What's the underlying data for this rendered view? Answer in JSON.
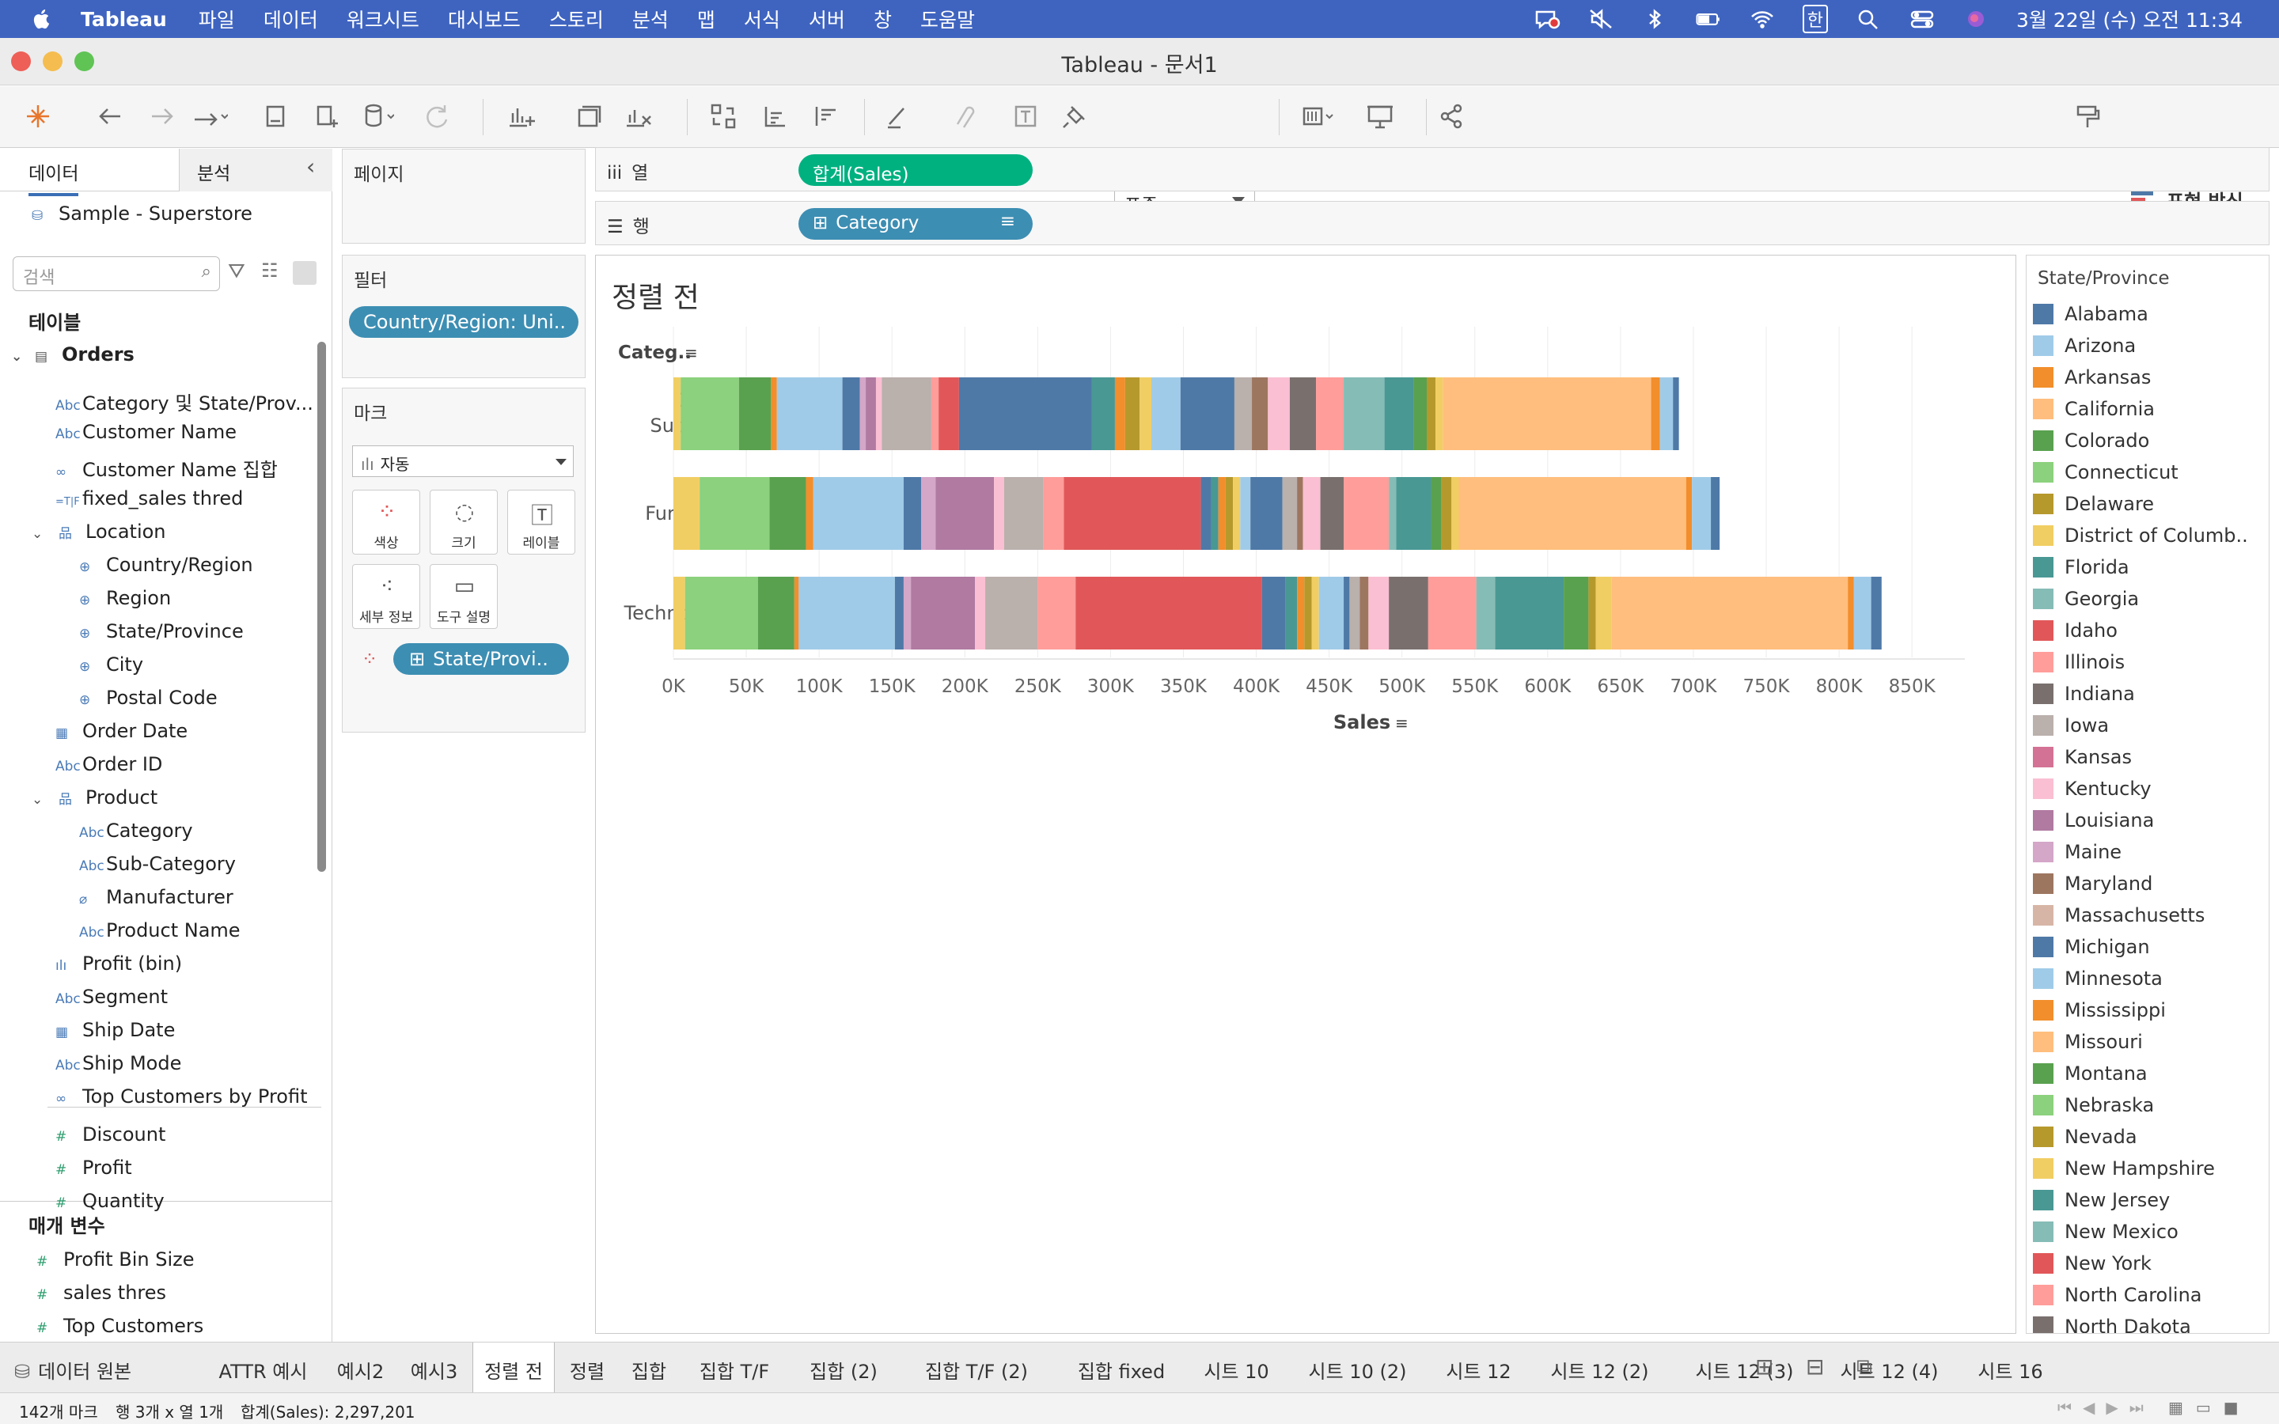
{
  "menubar": {
    "app": "Tableau",
    "items": [
      "파일",
      "데이터",
      "워크시트",
      "대시보드",
      "스토리",
      "분석",
      "맵",
      "서식",
      "서버",
      "창",
      "도움말"
    ],
    "clock": "3월 22일 (수) 오전 11:34",
    "input_lang": "한"
  },
  "window": {
    "title": "Tableau - 문서1"
  },
  "toolbar": {
    "fit": "표준",
    "show_me": "표현 방식"
  },
  "left": {
    "tab_data": "데이터",
    "tab_analytics": "분석",
    "datasource": "Sample - Superstore",
    "search_placeholder": "검색",
    "tables_header": "테이블",
    "table": "Orders",
    "fields": [
      {
        "icon": "Abc",
        "name": "Category 및 State/Prov..."
      },
      {
        "icon": "Abc",
        "name": "Customer Name"
      },
      {
        "icon": "∞",
        "name": "Customer Name 집합"
      },
      {
        "icon": "=T|F",
        "name": "fixed_sales thred"
      },
      {
        "icon": "品",
        "name": "Location"
      },
      {
        "icon": "⊕",
        "name": "Country/Region"
      },
      {
        "icon": "⊕",
        "name": "Region"
      },
      {
        "icon": "⊕",
        "name": "State/Province"
      },
      {
        "icon": "⊕",
        "name": "City"
      },
      {
        "icon": "⊕",
        "name": "Postal Code"
      },
      {
        "icon": "▦",
        "name": "Order Date"
      },
      {
        "icon": "Abc",
        "name": "Order ID"
      },
      {
        "icon": "品",
        "name": "Product"
      },
      {
        "icon": "Abc",
        "name": "Category"
      },
      {
        "icon": "Abc",
        "name": "Sub-Category"
      },
      {
        "icon": "⌀",
        "name": "Manufacturer"
      },
      {
        "icon": "Abc",
        "name": "Product Name"
      },
      {
        "icon": "ılı",
        "name": "Profit (bin)"
      },
      {
        "icon": "Abc",
        "name": "Segment"
      },
      {
        "icon": "▦",
        "name": "Ship Date"
      },
      {
        "icon": "Abc",
        "name": "Ship Mode"
      },
      {
        "icon": "∞",
        "name": "Top Customers by Profit"
      },
      {
        "icon": "#",
        "name": "Discount"
      },
      {
        "icon": "#",
        "name": "Profit"
      },
      {
        "icon": "#",
        "name": "Quantity"
      }
    ],
    "params_header": "매개 변수",
    "params": [
      "Profit Bin Size",
      "sales thres",
      "Top Customers"
    ]
  },
  "pages": {
    "title": "페이지"
  },
  "filters": {
    "title": "필터",
    "pill": "Country/Region: Uni.."
  },
  "marks": {
    "title": "마크",
    "type": "자동",
    "buttons": [
      "색상",
      "크기",
      "레이블",
      "세부 정보",
      "도구 설명"
    ],
    "pill": "State/Provi.."
  },
  "shelves": {
    "columns_label": "열",
    "columns_pill": "합계(Sales)",
    "rows_label": "행",
    "rows_pill": "Category"
  },
  "chart_data": {
    "type": "bar",
    "stacked": true,
    "orientation": "horizontal",
    "title": "정렬 전",
    "row_header": "Categ..",
    "xlabel": "Sales",
    "ylabel": "",
    "xlim": [
      0,
      870000
    ],
    "x_ticks": [
      "0K",
      "50K",
      "100K",
      "150K",
      "200K",
      "250K",
      "300K",
      "350K",
      "400K",
      "450K",
      "500K",
      "550K",
      "600K",
      "650K",
      "700K",
      "750K",
      "800K",
      "850K"
    ],
    "categories": [
      "Office Supplies",
      "Furniture",
      "Technology"
    ],
    "totals": [
      719047,
      741999,
      836154
    ],
    "stack_colors": [
      "#f1ce63",
      "#8cd17d",
      "#59a14f",
      "#f28e2b",
      "#a0cbe8",
      "#4e79a7",
      "#d4a6c8",
      "#b07aa1",
      "#fabfd2",
      "#bab0ac",
      "#ff9d9a",
      "#e15759",
      "#4e79a7",
      "#499894",
      "#f28e2b",
      "#b6992d",
      "#f1ce63",
      "#a0cbe8",
      "#4e79a7",
      "#bab0ac",
      "#9d7660",
      "#fabfd2",
      "#79706e",
      "#ff9d9a",
      "#86bcb6",
      "#499894",
      "#59a14f",
      "#b6992d",
      "#f1ce63",
      "#ffbe7d",
      "#f28e2b",
      "#a0cbe8",
      "#4e79a7"
    ],
    "series_values": {
      "Office Supplies": [
        5000,
        40000,
        22000,
        4000,
        45000,
        12000,
        4000,
        7000,
        4000,
        34000,
        5000,
        14000,
        91000,
        16000,
        7000,
        10000,
        8000,
        20000,
        37000,
        12000,
        11000,
        15000,
        18000,
        19000,
        28000,
        20000,
        9000,
        6000,
        5000,
        143000,
        6000,
        9000,
        4047
      ],
      "Furniture": [
        18000,
        48000,
        25000,
        5000,
        62000,
        12000,
        10000,
        40000,
        7000,
        27000,
        14000,
        94000,
        7000,
        5000,
        5000,
        5000,
        5000,
        7000,
        22000,
        10000,
        4000,
        12000,
        16000,
        31000,
        5000,
        24000,
        7000,
        7000,
        5000,
        156000,
        4000,
        13000,
        5999
      ],
      "Technology": [
        8000,
        50000,
        25000,
        3000,
        66000,
        6000,
        5000,
        44000,
        7000,
        36000,
        26000,
        128000,
        16000,
        8000,
        5000,
        5000,
        5000,
        17000,
        4000,
        7000,
        6000,
        14000,
        27000,
        33000,
        13000,
        47000,
        17000,
        5000,
        11000,
        162000,
        4000,
        12000,
        7154
      ]
    }
  },
  "legend": {
    "title": "State/Province",
    "items": [
      {
        "name": "Alabama",
        "color": "#4e79a7"
      },
      {
        "name": "Arizona",
        "color": "#a0cbe8"
      },
      {
        "name": "Arkansas",
        "color": "#f28e2b"
      },
      {
        "name": "California",
        "color": "#ffbe7d"
      },
      {
        "name": "Colorado",
        "color": "#59a14f"
      },
      {
        "name": "Connecticut",
        "color": "#8cd17d"
      },
      {
        "name": "Delaware",
        "color": "#b6992d"
      },
      {
        "name": "District of Columb..",
        "color": "#f1ce63"
      },
      {
        "name": "Florida",
        "color": "#499894"
      },
      {
        "name": "Georgia",
        "color": "#86bcb6"
      },
      {
        "name": "Idaho",
        "color": "#e15759"
      },
      {
        "name": "Illinois",
        "color": "#ff9d9a"
      },
      {
        "name": "Indiana",
        "color": "#79706e"
      },
      {
        "name": "Iowa",
        "color": "#bab0ac"
      },
      {
        "name": "Kansas",
        "color": "#d37295"
      },
      {
        "name": "Kentucky",
        "color": "#fabfd2"
      },
      {
        "name": "Louisiana",
        "color": "#b07aa1"
      },
      {
        "name": "Maine",
        "color": "#d4a6c8"
      },
      {
        "name": "Maryland",
        "color": "#9d7660"
      },
      {
        "name": "Massachusetts",
        "color": "#d7b5a6"
      },
      {
        "name": "Michigan",
        "color": "#4e79a7"
      },
      {
        "name": "Minnesota",
        "color": "#a0cbe8"
      },
      {
        "name": "Mississippi",
        "color": "#f28e2b"
      },
      {
        "name": "Missouri",
        "color": "#ffbe7d"
      },
      {
        "name": "Montana",
        "color": "#59a14f"
      },
      {
        "name": "Nebraska",
        "color": "#8cd17d"
      },
      {
        "name": "Nevada",
        "color": "#b6992d"
      },
      {
        "name": "New Hampshire",
        "color": "#f1ce63"
      },
      {
        "name": "New Jersey",
        "color": "#499894"
      },
      {
        "name": "New Mexico",
        "color": "#86bcb6"
      },
      {
        "name": "New York",
        "color": "#e15759"
      },
      {
        "name": "North Carolina",
        "color": "#ff9d9a"
      },
      {
        "name": "North Dakota",
        "color": "#79706e"
      }
    ]
  },
  "sheet_tabs": {
    "datasource": "데이터 원본",
    "tabs": [
      "ATTR 예시",
      "예시2",
      "예시3",
      "정렬 전",
      "정렬",
      "집합",
      "집합 T/F",
      "집합 (2)",
      "집합 T/F (2)",
      "집합 fixed",
      "시트 10",
      "시트 10 (2)",
      "시트 12",
      "시트 12 (2)",
      "시트 12 (3)",
      "시트 12 (4)",
      "시트 16"
    ],
    "active": "정렬 전"
  },
  "status": {
    "marks": "142개 마크",
    "rows_cols": "행 3개 x 열 1개",
    "sum": "합계(Sales): 2,297,201"
  }
}
